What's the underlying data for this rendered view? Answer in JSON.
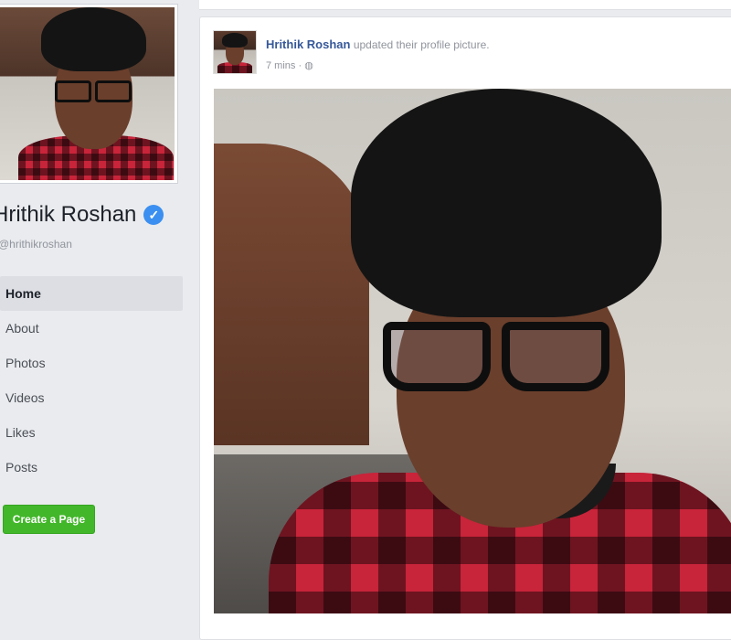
{
  "profile": {
    "name": "Hrithik Roshan",
    "username": "@hrithikroshan",
    "verified_icon": "check-icon"
  },
  "nav": {
    "items": [
      {
        "label": "Home",
        "active": true
      },
      {
        "label": "About",
        "active": false
      },
      {
        "label": "Photos",
        "active": false
      },
      {
        "label": "Videos",
        "active": false
      },
      {
        "label": "Likes",
        "active": false
      },
      {
        "label": "Posts",
        "active": false
      }
    ]
  },
  "create_page_button": "Create a Page",
  "post": {
    "author": "Hrithik Roshan",
    "action": "updated their profile picture.",
    "time": "7 mins",
    "separator": "·",
    "privacy_icon": "globe-icon"
  },
  "colors": {
    "background": "#e9ebee",
    "link": "#365899",
    "verified": "#3b8ff0",
    "create_button": "#42b72a"
  }
}
